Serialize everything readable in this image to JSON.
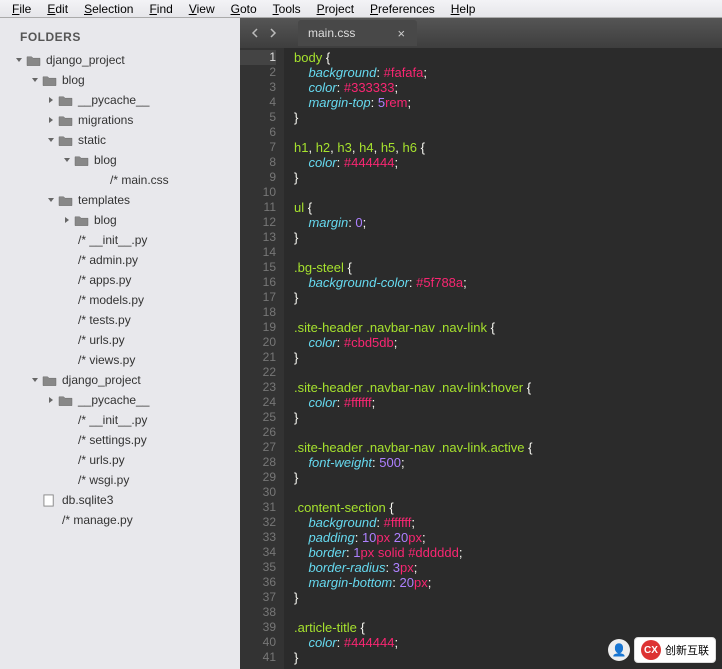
{
  "menu": [
    "File",
    "Edit",
    "Selection",
    "Find",
    "View",
    "Goto",
    "Tools",
    "Project",
    "Preferences",
    "Help"
  ],
  "sidebar": {
    "header": "FOLDERS",
    "tree": [
      {
        "lv": 0,
        "t": "folder",
        "open": true,
        "label": "django_project"
      },
      {
        "lv": 1,
        "t": "folder",
        "open": true,
        "label": "blog"
      },
      {
        "lv": 2,
        "t": "folder",
        "open": false,
        "label": "__pycache__"
      },
      {
        "lv": 2,
        "t": "folder",
        "open": false,
        "label": "migrations"
      },
      {
        "lv": 2,
        "t": "folder",
        "open": true,
        "label": "static"
      },
      {
        "lv": 3,
        "t": "folder",
        "open": true,
        "label": "blog"
      },
      {
        "lv": 4,
        "t": "file",
        "kind": "css",
        "label": "/*  main.css"
      },
      {
        "lv": 2,
        "t": "folder",
        "open": true,
        "label": "templates"
      },
      {
        "lv": 3,
        "t": "folder",
        "open": false,
        "label": "blog"
      },
      {
        "lv": 2,
        "t": "file",
        "kind": "py",
        "label": "/*  __init__.py"
      },
      {
        "lv": 2,
        "t": "file",
        "kind": "py",
        "label": "/*  admin.py"
      },
      {
        "lv": 2,
        "t": "file",
        "kind": "py",
        "label": "/*  apps.py"
      },
      {
        "lv": 2,
        "t": "file",
        "kind": "py",
        "label": "/*  models.py"
      },
      {
        "lv": 2,
        "t": "file",
        "kind": "py",
        "label": "/*  tests.py"
      },
      {
        "lv": 2,
        "t": "file",
        "kind": "py",
        "label": "/*  urls.py"
      },
      {
        "lv": 2,
        "t": "file",
        "kind": "py",
        "label": "/*  views.py"
      },
      {
        "lv": 1,
        "t": "folder",
        "open": true,
        "label": "django_project"
      },
      {
        "lv": 2,
        "t": "folder",
        "open": false,
        "label": "__pycache__"
      },
      {
        "lv": 2,
        "t": "file",
        "kind": "py",
        "label": "/*  __init__.py"
      },
      {
        "lv": 2,
        "t": "file",
        "kind": "py",
        "label": "/*  settings.py"
      },
      {
        "lv": 2,
        "t": "file",
        "kind": "py",
        "label": "/*  urls.py"
      },
      {
        "lv": 2,
        "t": "file",
        "kind": "py",
        "label": "/*  wsgi.py"
      },
      {
        "lv": 1,
        "t": "file",
        "kind": "db",
        "label": "db.sqlite3"
      },
      {
        "lv": 1,
        "t": "file",
        "kind": "py",
        "label": "/*  manage.py"
      }
    ]
  },
  "tab": {
    "label": "main.css"
  },
  "code": {
    "active_line": 1,
    "lines": [
      [
        [
          "sel",
          "body "
        ],
        [
          "punct",
          "{"
        ]
      ],
      [
        [
          "prop",
          "    background"
        ],
        [
          "punct",
          ": "
        ],
        [
          "hex",
          "#fafafa"
        ],
        [
          "punct",
          ";"
        ]
      ],
      [
        [
          "prop",
          "    color"
        ],
        [
          "punct",
          ": "
        ],
        [
          "hex",
          "#333333"
        ],
        [
          "punct",
          ";"
        ]
      ],
      [
        [
          "prop",
          "    margin-top"
        ],
        [
          "punct",
          ": "
        ],
        [
          "num",
          "5"
        ],
        [
          "kw",
          "rem"
        ],
        [
          "punct",
          ";"
        ]
      ],
      [
        [
          "punct",
          "}"
        ]
      ],
      [],
      [
        [
          "sel",
          "h1"
        ],
        [
          "punct",
          ", "
        ],
        [
          "sel",
          "h2"
        ],
        [
          "punct",
          ", "
        ],
        [
          "sel",
          "h3"
        ],
        [
          "punct",
          ", "
        ],
        [
          "sel",
          "h4"
        ],
        [
          "punct",
          ", "
        ],
        [
          "sel",
          "h5"
        ],
        [
          "punct",
          ", "
        ],
        [
          "sel",
          "h6 "
        ],
        [
          "punct",
          "{"
        ]
      ],
      [
        [
          "prop",
          "    color"
        ],
        [
          "punct",
          ": "
        ],
        [
          "hex",
          "#444444"
        ],
        [
          "punct",
          ";"
        ]
      ],
      [
        [
          "punct",
          "}"
        ]
      ],
      [],
      [
        [
          "sel",
          "ul "
        ],
        [
          "punct",
          "{"
        ]
      ],
      [
        [
          "prop",
          "    margin"
        ],
        [
          "punct",
          ": "
        ],
        [
          "num",
          "0"
        ],
        [
          "punct",
          ";"
        ]
      ],
      [
        [
          "punct",
          "}"
        ]
      ],
      [],
      [
        [
          "sel",
          ".bg-steel "
        ],
        [
          "punct",
          "{"
        ]
      ],
      [
        [
          "prop",
          "    background-color"
        ],
        [
          "punct",
          ": "
        ],
        [
          "hex",
          "#5f788a"
        ],
        [
          "punct",
          ";"
        ]
      ],
      [
        [
          "punct",
          "}"
        ]
      ],
      [],
      [
        [
          "sel",
          ".site-header "
        ],
        [
          "sel",
          ".navbar-nav "
        ],
        [
          "sel",
          ".nav-link "
        ],
        [
          "punct",
          "{"
        ]
      ],
      [
        [
          "prop",
          "    color"
        ],
        [
          "punct",
          ": "
        ],
        [
          "hex",
          "#cbd5db"
        ],
        [
          "punct",
          ";"
        ]
      ],
      [
        [
          "punct",
          "}"
        ]
      ],
      [],
      [
        [
          "sel",
          ".site-header "
        ],
        [
          "sel",
          ".navbar-nav "
        ],
        [
          "sel",
          ".nav-link"
        ],
        [
          "punct",
          ":"
        ],
        [
          "sel",
          "hover "
        ],
        [
          "punct",
          "{"
        ]
      ],
      [
        [
          "prop",
          "    color"
        ],
        [
          "punct",
          ": "
        ],
        [
          "hex",
          "#ffffff"
        ],
        [
          "punct",
          ";"
        ]
      ],
      [
        [
          "punct",
          "}"
        ]
      ],
      [],
      [
        [
          "sel",
          ".site-header "
        ],
        [
          "sel",
          ".navbar-nav "
        ],
        [
          "sel",
          ".nav-link"
        ],
        [
          "sel",
          ".active "
        ],
        [
          "punct",
          "{"
        ]
      ],
      [
        [
          "prop",
          "    font-weight"
        ],
        [
          "punct",
          ": "
        ],
        [
          "num",
          "500"
        ],
        [
          "punct",
          ";"
        ]
      ],
      [
        [
          "punct",
          "}"
        ]
      ],
      [],
      [
        [
          "sel",
          ".content-section "
        ],
        [
          "punct",
          "{"
        ]
      ],
      [
        [
          "prop",
          "    background"
        ],
        [
          "punct",
          ": "
        ],
        [
          "hex",
          "#ffffff"
        ],
        [
          "punct",
          ";"
        ]
      ],
      [
        [
          "prop",
          "    padding"
        ],
        [
          "punct",
          ": "
        ],
        [
          "num",
          "10"
        ],
        [
          "kw",
          "px "
        ],
        [
          "num",
          "20"
        ],
        [
          "kw",
          "px"
        ],
        [
          "punct",
          ";"
        ]
      ],
      [
        [
          "prop",
          "    border"
        ],
        [
          "punct",
          ": "
        ],
        [
          "num",
          "1"
        ],
        [
          "kw",
          "px "
        ],
        [
          "kw",
          "solid "
        ],
        [
          "hex",
          "#dddddd"
        ],
        [
          "punct",
          ";"
        ]
      ],
      [
        [
          "prop",
          "    border-radius"
        ],
        [
          "punct",
          ": "
        ],
        [
          "num",
          "3"
        ],
        [
          "kw",
          "px"
        ],
        [
          "punct",
          ";"
        ]
      ],
      [
        [
          "prop",
          "    margin-bottom"
        ],
        [
          "punct",
          ": "
        ],
        [
          "num",
          "20"
        ],
        [
          "kw",
          "px"
        ],
        [
          "punct",
          ";"
        ]
      ],
      [
        [
          "punct",
          "}"
        ]
      ],
      [],
      [
        [
          "sel",
          ".article-title "
        ],
        [
          "punct",
          "{"
        ]
      ],
      [
        [
          "prop",
          "    color"
        ],
        [
          "punct",
          ": "
        ],
        [
          "hex",
          "#444444"
        ],
        [
          "punct",
          ";"
        ]
      ],
      [
        [
          "punct",
          "}"
        ]
      ]
    ]
  },
  "watermark": {
    "text": "创新互联"
  }
}
